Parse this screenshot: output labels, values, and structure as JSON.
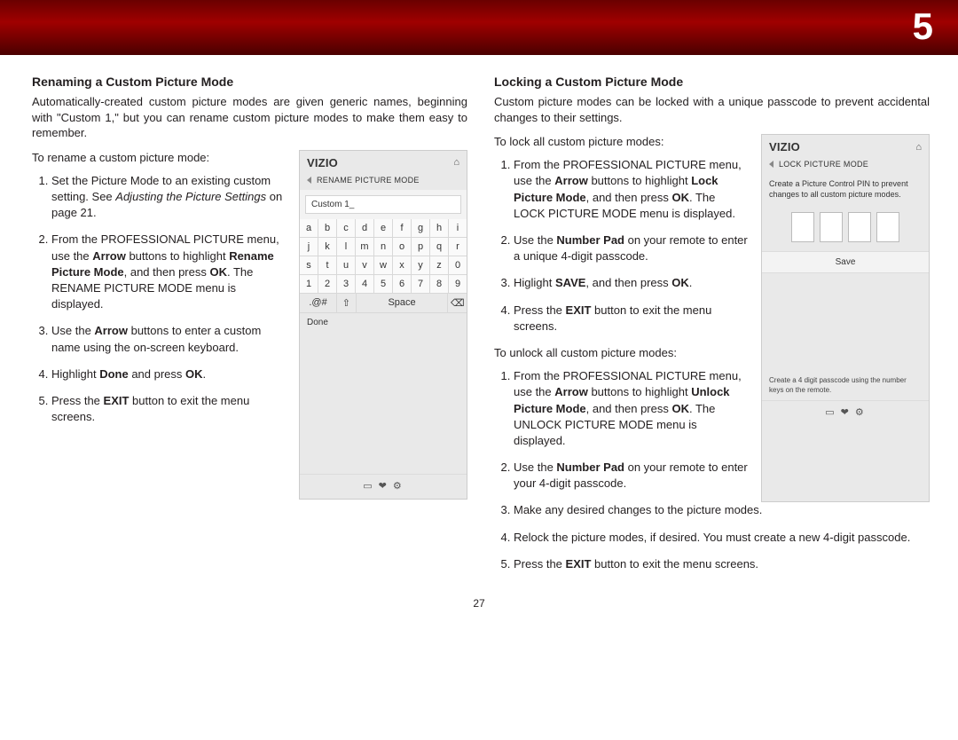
{
  "header": {
    "chapter_number": "5"
  },
  "page_number": "27",
  "left": {
    "title": "Renaming a Custom Picture Mode",
    "intro": "Automatically-created custom picture modes are given generic names, beginning with \"Custom 1,\" but you can rename custom picture modes to make them easy to remember.",
    "lead": "To rename a custom picture mode:",
    "steps": [
      "Set the Picture Mode to an existing custom setting. See <span class='i'>Adjusting the Picture Settings</span> on page 21.",
      "From the PROFESSIONAL PICTURE menu, use the <span class='b'>Arrow</span> buttons to highlight <span class='b'>Rename Picture Mode</span>, and then press <span class='b'>OK</span>. The RENAME PICTURE MODE menu is displayed.",
      "Use the <span class='b'>Arrow</span> buttons to enter a custom name using the on-screen keyboard.",
      "Highlight <span class='b'>Done</span> and press <span class='b'>OK</span>.",
      "Press the <span class='b'>EXIT</span> button to exit the menu screens."
    ],
    "screen": {
      "logo": "VIZIO",
      "sub": "RENAME PICTURE MODE",
      "input": "Custom 1_",
      "kbd_rows": [
        [
          "a",
          "b",
          "c",
          "d",
          "e",
          "f",
          "g",
          "h",
          "i"
        ],
        [
          "j",
          "k",
          "l",
          "m",
          "n",
          "o",
          "p",
          "q",
          "r"
        ],
        [
          "s",
          "t",
          "u",
          "v",
          "w",
          "x",
          "y",
          "z",
          "0"
        ],
        [
          "1",
          "2",
          "3",
          "4",
          "5",
          "6",
          "7",
          "8",
          "9"
        ]
      ],
      "bottom_sym": ".@#",
      "bottom_shift": "⇧",
      "bottom_space": "Space",
      "bottom_bksp": "⌫",
      "done": "Done",
      "foot": "▭  ❤  ⚙"
    }
  },
  "right": {
    "title": "Locking a Custom Picture Mode",
    "intro": "Custom picture modes can be locked with a unique passcode to prevent accidental changes to their settings.",
    "lead1": "To lock all custom picture modes:",
    "lock_steps": [
      "From the PROFESSIONAL PICTURE menu, use the <span class='b'>Arrow</span> buttons to highlight <span class='b'>Lock Picture Mode</span>, and then press <span class='b'>OK</span>. The LOCK PICTURE MODE menu is displayed.",
      "Use the <span class='b'>Number Pad</span> on your remote to enter a unique 4-digit passcode.",
      "Higlight <span class='b'>SAVE</span>, and then press <span class='b'>OK</span>.",
      "Press the <span class='b'>EXIT</span> button to exit the menu screens."
    ],
    "lead2": "To unlock all custom picture modes:",
    "unlock_steps": [
      "From the PROFESSIONAL PICTURE menu, use the <span class='b'>Arrow</span> buttons to highlight <span class='b'>Unlock Picture Mode</span>, and then press <span class='b'>OK</span>. The UNLOCK PICTURE MODE menu is displayed.",
      "Use the <span class='b'>Number Pad</span> on your remote to enter your 4-digit passcode.",
      "Make any desired changes to the picture modes.",
      "Relock the picture modes, if desired. You must create a new 4-digit passcode.",
      "Press the <span class='b'>EXIT</span> button to exit the menu screens."
    ],
    "screen": {
      "logo": "VIZIO",
      "sub": "LOCK PICTURE MODE",
      "desc": "Create a Picture Control PIN to prevent changes to all custom picture modes.",
      "save": "Save",
      "note": "Create a 4 digit passcode using the number keys on the remote.",
      "foot": "▭  ❤  ⚙"
    }
  }
}
